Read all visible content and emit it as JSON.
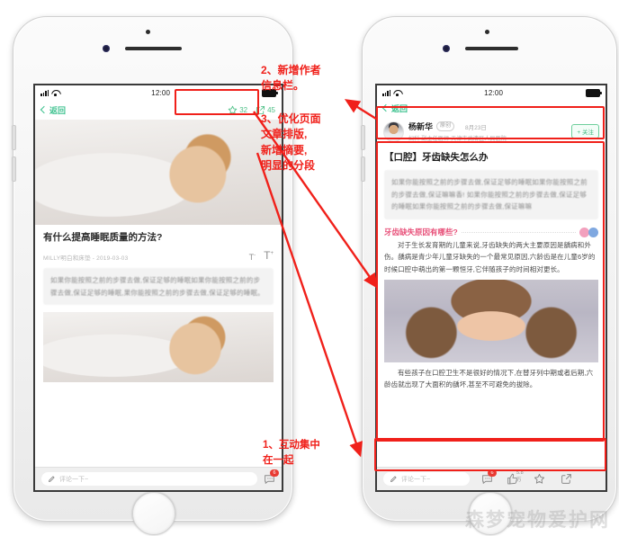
{
  "status_bar": {
    "time": "12:00"
  },
  "left_phone": {
    "nav": {
      "back_label": "返回",
      "favorite_count": "32",
      "share_count": "45"
    },
    "article": {
      "title": "有什么提高睡眠质量的方法?",
      "byline": "MILLY明白和床垫 -  2019-03-03",
      "font_smaller": "T",
      "font_smaller_sup": "-",
      "font_larger": "T",
      "font_larger_sup": "+",
      "summary": "如果你能按照之前的步骤去做,保证足够的睡眠如果你能按照之前的步骤去做,保证足够的睡眠,果你能按照之前的步骤去做,保证足够的睡眠。"
    },
    "bottom": {
      "comment_placeholder": "评论一下~",
      "comment_badge": "6"
    }
  },
  "right_phone": {
    "nav": {
      "back_label": "返回"
    },
    "author": {
      "name": "杨新华",
      "original_badge": "原创",
      "date": "8月23日",
      "credentials": "妇科  副主任医师   天津市武清区人民医院",
      "follow_label": "+ 关注"
    },
    "article": {
      "title": "【口腔】牙齿缺失怎么办",
      "summary": "如果你能按照之前的步骤去做,保证足够的睡眠如果你能按照之前的步骤去做,保证嘛嘛香! 如果你能按照之前的步骤去做,保证足够的睡眠如果你能按照之前的步骤去做,保证嘛嘛",
      "section_heading": "牙齿缺失原因有哪些?",
      "paragraph_1": "对于生长发育期的儿童来说,牙齿缺失的两大主要原因是龋病和外伤。龋病是青少年儿童牙缺失的一个最常见原因,六龄齿是在儿童6岁的时候口腔中萌出的第一颗恒牙,它伴随孩子的时间相对更长。",
      "paragraph_2": "有些孩子在口腔卫生不是很好的情况下,在替牙列中期或者后期,六龄齿就出现了大面积的龋坏,甚至不可避免的拔除。"
    },
    "bottom": {
      "comment_placeholder": "评论一下~",
      "comment_badge": "6",
      "like_count": "5.8万"
    }
  },
  "annotations": {
    "note_1": "1、互动集中\n    在一起",
    "note_2": "2、新增作者\n    信息栏。",
    "note_3": "3、优化页面\n    文章排版,\n    新增摘要,\n    明显的分段"
  },
  "watermark": "森梦宠物爱护网",
  "colors": {
    "accent_green": "#4cbf86",
    "annotation_red": "#f0201a",
    "section_pink": "#e8517a"
  }
}
